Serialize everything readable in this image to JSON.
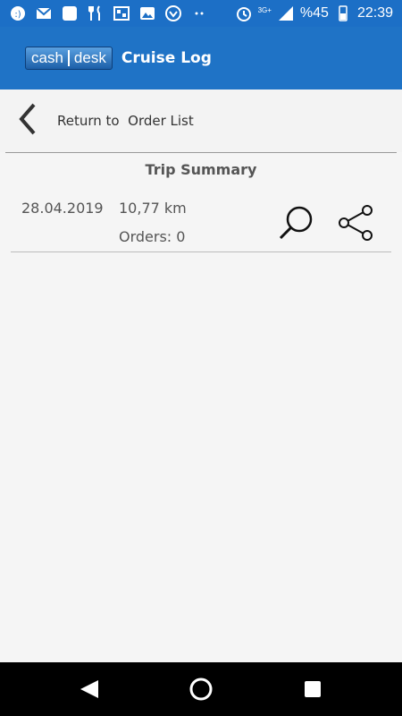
{
  "status_bar": {
    "icons": [
      "chat-icon",
      "gmail-icon",
      "app-icon",
      "restaurant-icon",
      "image-icon",
      "gallery-icon",
      "vpn-icon",
      "more-icon"
    ],
    "network": "3G+",
    "battery": "%45",
    "time": "22:39"
  },
  "app_bar": {
    "logo_left": "cash",
    "logo_right": "desk",
    "title": "Cruise Log",
    "color": "#1f73c6"
  },
  "nav": {
    "back_label": "Return to  Order List"
  },
  "section": {
    "title": "Trip Summary"
  },
  "trip": {
    "date": "28.04.2019",
    "distance": "10,77 km",
    "orders": "Orders: 0"
  }
}
